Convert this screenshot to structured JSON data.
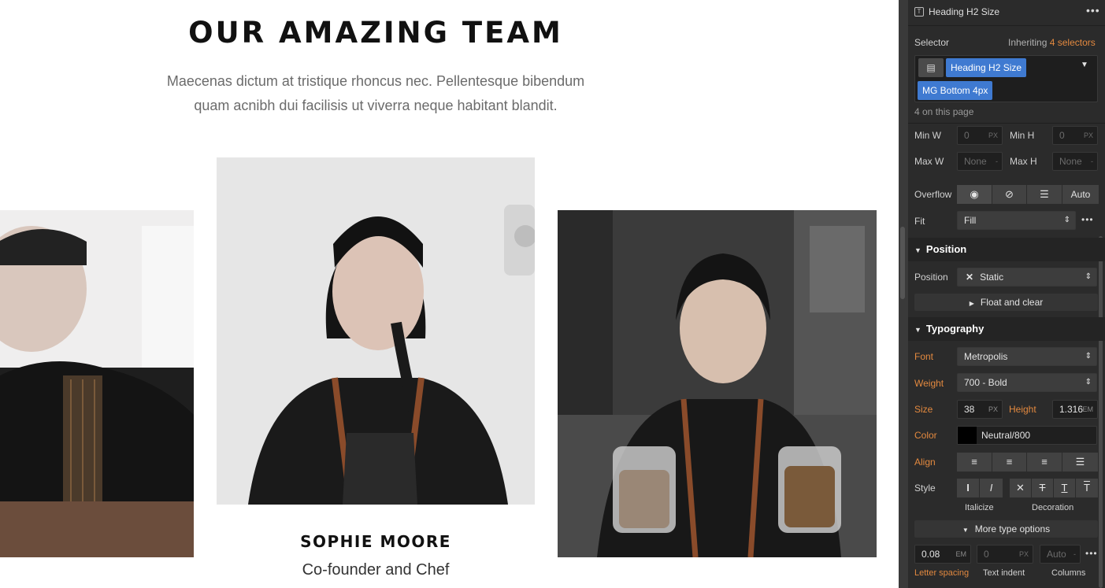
{
  "canvas": {
    "heading": "OUR AMAZING TEAM",
    "subtitle_line1": "Maecenas dictum at tristique rhoncus nec. Pellentesque bibendum",
    "subtitle_line2": "quam acnibh dui facilisis ut viverra neque habitant blandit.",
    "featured_member": {
      "name": "SOPHIE MOORE",
      "role": "Co-founder and Chef"
    }
  },
  "panel": {
    "header": {
      "title": "Heading H2 Size",
      "menu": "•••",
      "icon": "text-style-icon"
    },
    "selector": {
      "label": "Selector",
      "inheriting_prefix": "Inheriting",
      "inheriting_count": "4 selectors",
      "chips": [
        "Heading H2 Size",
        "MG Bottom 4px"
      ],
      "on_page": "4 on this page"
    },
    "size": {
      "min_w_label": "Min W",
      "min_w_value": "0",
      "min_w_unit": "PX",
      "min_h_label": "Min H",
      "min_h_value": "0",
      "min_h_unit": "PX",
      "max_w_label": "Max W",
      "max_w_value": "None",
      "max_w_unit": "-",
      "max_h_label": "Max H",
      "max_h_value": "None",
      "max_h_unit": "-",
      "overflow_label": "Overflow",
      "overflow_auto": "Auto",
      "fit_label": "Fit",
      "fit_value": "Fill",
      "fit_more": "•••"
    },
    "position": {
      "section": "Position",
      "label": "Position",
      "value": "Static",
      "float_clear": "Float and clear"
    },
    "typography": {
      "section": "Typography",
      "font_label": "Font",
      "font_value": "Metropolis",
      "weight_label": "Weight",
      "weight_value": "700 - Bold",
      "size_label": "Size",
      "size_value": "38",
      "size_unit": "PX",
      "height_label": "Height",
      "height_value": "1.316",
      "height_unit": "EM",
      "color_label": "Color",
      "color_value": "Neutral/800",
      "color_swatch": "#000000",
      "align_label": "Align",
      "style_label": "Style",
      "italicize_label": "Italicize",
      "decoration_label": "Decoration",
      "more_options": "More type options",
      "letter_spacing_value": "0.08",
      "letter_spacing_unit": "EM",
      "letter_spacing_label": "Letter spacing",
      "text_indent_value": "0",
      "text_indent_unit": "PX",
      "text_indent_label": "Text indent",
      "columns_value": "Auto",
      "columns_unit": "-",
      "columns_label": "Columns",
      "more": "•••"
    },
    "colors": {
      "accent_orange": "#e3893f",
      "chip_blue": "#3f7ad1",
      "panel_bg": "#2b2b2b"
    }
  }
}
